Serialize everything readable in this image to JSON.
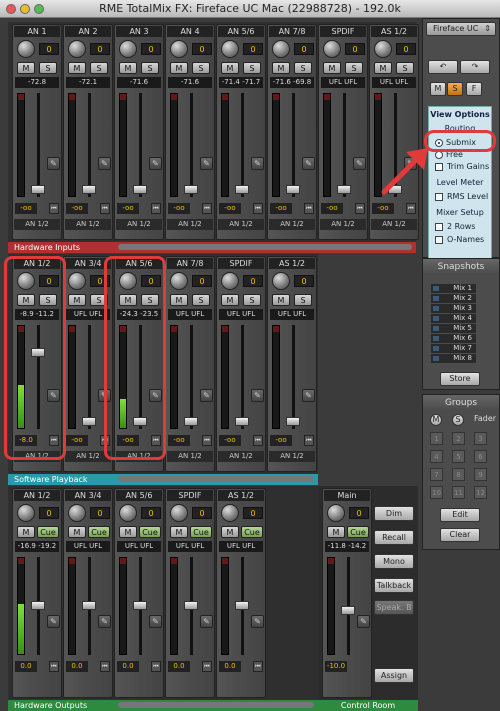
{
  "window": {
    "title": "RME TotalMix FX: Fireface UC Mac (22988728) - 192.0k"
  },
  "colors": {
    "hardware_inputs": "#b03030",
    "software_playback": "#2a9aa8",
    "hardware_outputs": "#2e8a3e",
    "control_room": "#2e8a3e",
    "highlight": "#e03a3a"
  },
  "hardware_inputs": {
    "label": "Hardware Inputs",
    "channels": [
      {
        "name": "AN 1",
        "gain": "0",
        "level": "-72.8",
        "routing": "AN 1/2",
        "volume": "-oo"
      },
      {
        "name": "AN 2",
        "gain": "0",
        "level": "-72.1",
        "routing": "AN 1/2",
        "volume": "-oo"
      },
      {
        "name": "AN 3",
        "gain": "0",
        "level": "-71.6",
        "routing": "AN 1/2",
        "volume": "-oo"
      },
      {
        "name": "AN 4",
        "gain": "0",
        "level": "-71.6",
        "routing": "AN 1/2",
        "volume": "-oo"
      },
      {
        "name": "AN 5/6",
        "gain": "0",
        "level": "-71.4  -71.7",
        "routing": "AN 1/2",
        "volume": "-oo"
      },
      {
        "name": "AN 7/8",
        "gain": "0",
        "level": "-71.6  -69.8",
        "routing": "AN 1/2",
        "volume": "-oo"
      },
      {
        "name": "SPDIF",
        "gain": "0",
        "level": "UFL  UFL",
        "routing": "AN 1/2",
        "volume": "-oo"
      },
      {
        "name": "AS 1/2",
        "gain": "0",
        "level": "UFL  UFL",
        "routing": "AN 1/2",
        "volume": "-oo"
      }
    ]
  },
  "software_playback": {
    "label": "Software Playback",
    "channels": [
      {
        "name": "AN 1/2",
        "gain": "0",
        "level": "-8.9  -11.2",
        "routing": "AN 1/2",
        "volume": "-8.0",
        "meter": 0.45
      },
      {
        "name": "AN 3/4",
        "gain": "0",
        "level": "UFL  UFL",
        "routing": "AN 1/2",
        "volume": "-oo",
        "meter": 0
      },
      {
        "name": "AN 5/6",
        "gain": "0",
        "level": "-24.3  -23.5",
        "routing": "AN 1/2",
        "volume": "-oo",
        "meter": 0.3
      },
      {
        "name": "AN 7/8",
        "gain": "0",
        "level": "UFL  UFL",
        "routing": "AN 1/2",
        "volume": "-oo",
        "meter": 0
      },
      {
        "name": "SPDIF",
        "gain": "0",
        "level": "UFL  UFL",
        "routing": "AN 1/2",
        "volume": "-oo",
        "meter": 0
      },
      {
        "name": "AS 1/2",
        "gain": "0",
        "level": "UFL  UFL",
        "routing": "AN 1/2",
        "volume": "-oo",
        "meter": 0
      }
    ]
  },
  "hardware_outputs": {
    "label": "Hardware Outputs",
    "channels": [
      {
        "name": "AN 1/2",
        "gain": "0",
        "level": "-16.9  -19.2",
        "routing": "",
        "volume": "0.0",
        "meter": 0.55
      },
      {
        "name": "AN 3/4",
        "gain": "0",
        "level": "UFL  UFL",
        "routing": "",
        "volume": "0.0",
        "meter": 0
      },
      {
        "name": "AN 5/6",
        "gain": "0",
        "level": "UFL  UFL",
        "routing": "",
        "volume": "0.0",
        "meter": 0
      },
      {
        "name": "SPDIF",
        "gain": "0",
        "level": "UFL  UFL",
        "routing": "",
        "volume": "0.0",
        "meter": 0
      },
      {
        "name": "AS 1/2",
        "gain": "0",
        "level": "UFL  UFL",
        "routing": "",
        "volume": "0.0",
        "meter": 0
      }
    ]
  },
  "control_room": {
    "label": "Control Room",
    "main": {
      "name": "Main",
      "gain": "0",
      "level": "-11.8  -14.2",
      "volume": "-10.0"
    },
    "buttons": [
      "Dim",
      "Recall",
      "Mono",
      "Talkback",
      "Speak. B",
      "Assign"
    ]
  },
  "buttons": {
    "m": "M",
    "s": "S",
    "cue": "Cue",
    "f": "F"
  },
  "device_select": {
    "value": "Fireface UC"
  },
  "view_options": {
    "title": "View Options",
    "routing": "Routing",
    "submix": "Submix",
    "free": "Free",
    "trim_gains": "Trim Gains",
    "level_meter": "Level Meter",
    "rms_level": "RMS Level",
    "mixer_setup": "Mixer Setup",
    "two_rows": "2 Rows",
    "o_names": "O-Names"
  },
  "snapshots": {
    "title": "Snapshots",
    "items": [
      "Mix 1",
      "Mix 2",
      "Mix 3",
      "Mix 4",
      "Mix 5",
      "Mix 6",
      "Mix 7",
      "Mix 8"
    ],
    "store": "Store"
  },
  "groups": {
    "title": "Groups",
    "m": "M",
    "s": "S",
    "fader": "Fader",
    "edit": "Edit",
    "clear": "Clear"
  }
}
